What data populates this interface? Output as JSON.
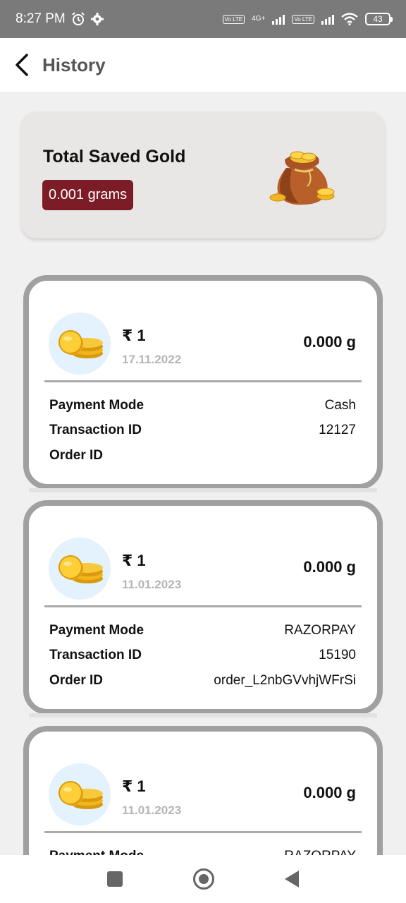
{
  "status_bar": {
    "time": "8:27 PM",
    "net_badge_1": "Vo LTE",
    "net_type": "4G+",
    "net_badge_2": "Vo LTE",
    "battery": "43"
  },
  "header": {
    "title": "History"
  },
  "summary": {
    "title": "Total Saved Gold",
    "amount": "0.001 grams"
  },
  "labels": {
    "payment_mode": "Payment Mode",
    "transaction_id": "Transaction ID",
    "order_id": "Order ID"
  },
  "transactions": [
    {
      "amount": "₹ 1",
      "date": "17.11.2022",
      "grams": "0.000 g",
      "payment_mode": "Cash",
      "transaction_id": "12127",
      "order_id": ""
    },
    {
      "amount": "₹ 1",
      "date": "11.01.2023",
      "grams": "0.000 g",
      "payment_mode": "RAZORPAY",
      "transaction_id": "15190",
      "order_id": "order_L2nbGVvhjWFrSi"
    },
    {
      "amount": "₹ 1",
      "date": "11.01.2023",
      "grams": "0.000 g",
      "payment_mode": "RAZORPAY",
      "transaction_id": "",
      "order_id": ""
    }
  ],
  "colors": {
    "badge_bg": "#7b1c26",
    "card_border": "#a0a0a0",
    "coin_bg": "#e3f2fc",
    "gold": "#f2b51d"
  }
}
